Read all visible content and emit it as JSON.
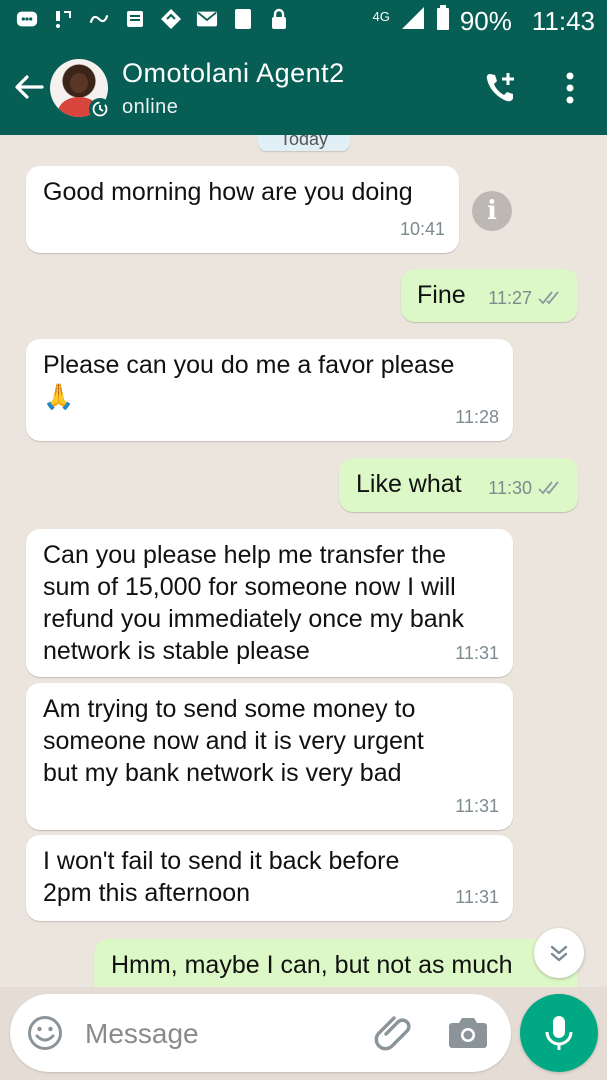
{
  "status_bar": {
    "network": "4G",
    "battery": "90%",
    "time": "11:43",
    "icons": [
      "notification-icon",
      "missed-call-icon",
      "link-icon",
      "news-icon",
      "app-icon",
      "mail-icon",
      "tablet-icon",
      "lock-icon",
      "signal-icon",
      "battery-icon"
    ]
  },
  "header": {
    "contact_name": "Omotolani Agent2",
    "status": "online",
    "icons": [
      "back-arrow-icon",
      "avatar",
      "disappearing-timer-icon",
      "add-call-icon",
      "more-vert-icon"
    ]
  },
  "chat": {
    "date_label": "Today",
    "messages": [
      {
        "direction": "in",
        "text": "Good morning how are you doing",
        "time": "10:41"
      },
      {
        "direction": "out",
        "text": "Fine",
        "time": "11:27",
        "receipt": "double-tick"
      },
      {
        "direction": "in",
        "text": "Please can you do me a favor please",
        "emoji": "🙏",
        "time": "11:28"
      },
      {
        "direction": "out",
        "text": "Like what",
        "time": "11:30",
        "receipt": "double-tick"
      },
      {
        "direction": "in",
        "text": "Can you please help me transfer the sum of 15,000 for someone now I will refund you immediately once my bank network is stable please",
        "time": "11:31"
      },
      {
        "direction": "in",
        "text": "Am trying to send some money to someone now and it is very urgent but my bank network is very bad",
        "time": "11:31"
      },
      {
        "direction": "in",
        "text": "I won't fail to send it back before 2pm this afternoon",
        "time": "11:31"
      },
      {
        "direction": "out",
        "text": "Hmm, maybe I can, but not as much",
        "time": ""
      }
    ]
  },
  "composer": {
    "placeholder": "Message",
    "icons": [
      "emoji-icon",
      "attach-icon",
      "camera-icon",
      "mic-icon"
    ]
  },
  "colors": {
    "header": "#075e54",
    "incoming_bubble": "#ffffff",
    "outgoing_bubble": "#dcf8c6",
    "wallpaper": "#ece5dd",
    "accent": "#00a884"
  }
}
